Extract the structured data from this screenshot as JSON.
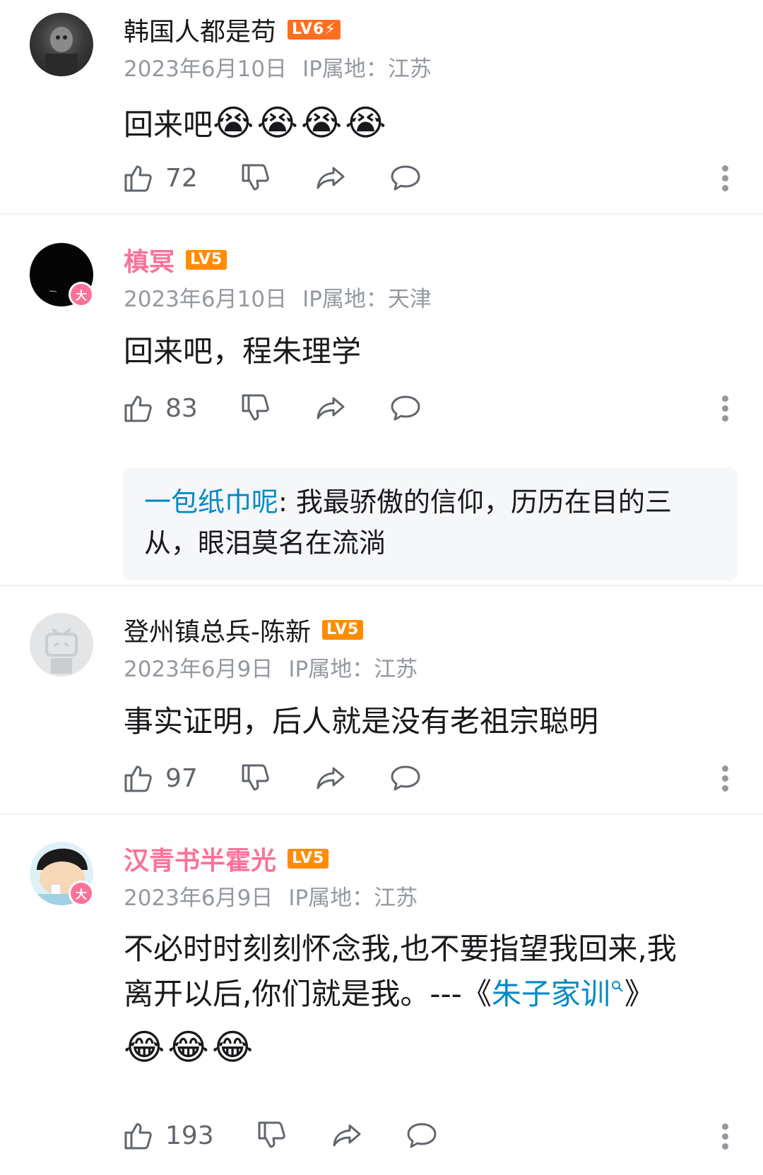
{
  "comments": [
    {
      "user": "韩国人都是苟",
      "level": "LV6⚡",
      "date": "2023年6月10日",
      "ip": "IP属地：江苏",
      "text": "回来吧",
      "emoji": "😭😭😭😭",
      "likes": "72"
    },
    {
      "user": "槙冥",
      "level": "LV5",
      "badge": "大",
      "date": "2023年6月10日",
      "ip": "IP属地：天津",
      "text": "回来吧，程朱理学",
      "likes": "83",
      "reply": {
        "user": "一包纸巾呢",
        "separator": ": ",
        "text": "我最骄傲的信仰，历历在目的三从，眼泪莫名在流淌"
      }
    },
    {
      "user": "登州镇总兵-陈新",
      "level": "LV5",
      "date": "2023年6月9日",
      "ip": "IP属地：江苏",
      "text": "事实证明，后人就是没有老祖宗聪明",
      "likes": "97"
    },
    {
      "user": "汉青书半霍光",
      "level": "LV5",
      "badge": "大",
      "date": "2023年6月9日",
      "ip": "IP属地：江苏",
      "text_before": "不必时时刻刻怀念我,也不要指望我回来,我离开以后,你们就是我。---《",
      "link": "朱子家训",
      "text_after": "》",
      "emoji": "😂😂😂",
      "likes": "193"
    }
  ],
  "icons": [
    "like-icon",
    "dislike-icon",
    "share-icon",
    "reply-icon",
    "more-icon",
    "search-icon"
  ]
}
